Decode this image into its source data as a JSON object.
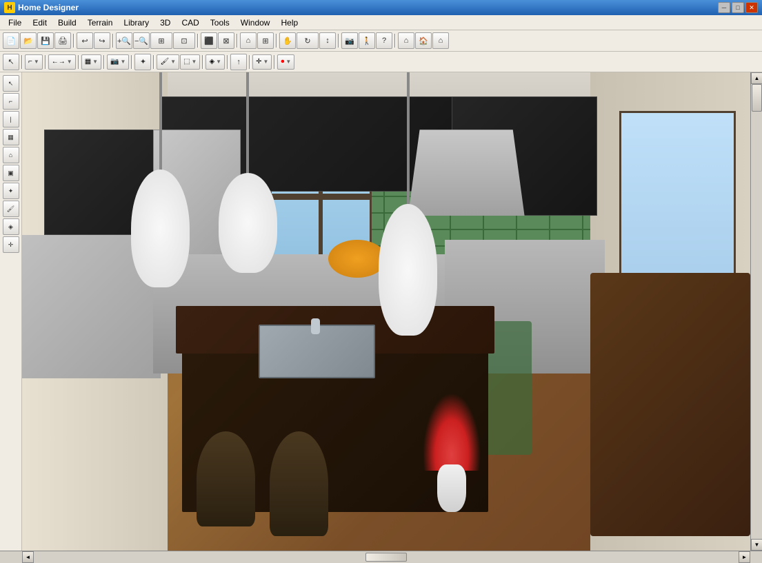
{
  "window": {
    "title": "Home Designer",
    "icon": "H"
  },
  "titlebar": {
    "minimize": "─",
    "maximize": "□",
    "close": "✕"
  },
  "menubar": {
    "items": [
      {
        "id": "file",
        "label": "File"
      },
      {
        "id": "edit",
        "label": "Edit"
      },
      {
        "id": "build",
        "label": "Build"
      },
      {
        "id": "terrain",
        "label": "Terrain"
      },
      {
        "id": "library",
        "label": "Library"
      },
      {
        "id": "3d",
        "label": "3D"
      },
      {
        "id": "cad",
        "label": "CAD"
      },
      {
        "id": "tools",
        "label": "Tools"
      },
      {
        "id": "window",
        "label": "Window"
      },
      {
        "id": "help",
        "label": "Help"
      }
    ]
  },
  "toolbar1": {
    "buttons": [
      {
        "id": "new",
        "icon": "📄",
        "label": "New"
      },
      {
        "id": "open",
        "icon": "📂",
        "label": "Open"
      },
      {
        "id": "save",
        "icon": "💾",
        "label": "Save"
      },
      {
        "id": "print",
        "icon": "🖨",
        "label": "Print"
      },
      {
        "id": "undo",
        "icon": "↩",
        "label": "Undo"
      },
      {
        "id": "redo",
        "icon": "↪",
        "label": "Redo"
      },
      {
        "id": "zoomout",
        "icon": "🔍",
        "label": "Zoom Out"
      },
      {
        "id": "zoomin",
        "icon": "🔎",
        "label": "Zoom In"
      },
      {
        "id": "zoomall",
        "icon": "⊞",
        "label": "Zoom All"
      },
      {
        "id": "zoomfit",
        "icon": "⊡",
        "label": "Zoom Fit"
      },
      {
        "id": "fill",
        "icon": "▣",
        "label": "Fill Window"
      },
      {
        "id": "pan",
        "icon": "✋",
        "label": "Pan"
      },
      {
        "id": "orbit",
        "icon": "⟳",
        "label": "Orbit"
      },
      {
        "id": "updown",
        "icon": "↕",
        "label": "Up/Down"
      }
    ]
  },
  "toolbar2": {
    "buttons": [
      {
        "id": "select",
        "icon": "↖",
        "label": "Select"
      },
      {
        "id": "polyline",
        "icon": "⌐",
        "label": "Polyline"
      },
      {
        "id": "measure",
        "icon": "←→",
        "label": "Measure"
      },
      {
        "id": "dimension",
        "icon": "▦",
        "label": "Dimension"
      },
      {
        "id": "camera",
        "icon": "⌂",
        "label": "Camera"
      },
      {
        "id": "light",
        "icon": "✦",
        "label": "Light"
      },
      {
        "id": "paint",
        "icon": "🖌",
        "label": "Paint"
      },
      {
        "id": "texture",
        "icon": "⬚",
        "label": "Texture"
      },
      {
        "id": "materials",
        "icon": "◈",
        "label": "Materials"
      },
      {
        "id": "move",
        "icon": "✛",
        "label": "Move"
      },
      {
        "id": "record",
        "icon": "⏺",
        "label": "Record"
      }
    ]
  },
  "scene": {
    "description": "3D kitchen interior render",
    "floor_material": "hardwood",
    "wall_material": "green_subway_tile",
    "cabinet_color": "dark_charcoal"
  },
  "scrollbars": {
    "up_arrow": "▲",
    "down_arrow": "▼",
    "left_arrow": "◄",
    "right_arrow": "►"
  }
}
